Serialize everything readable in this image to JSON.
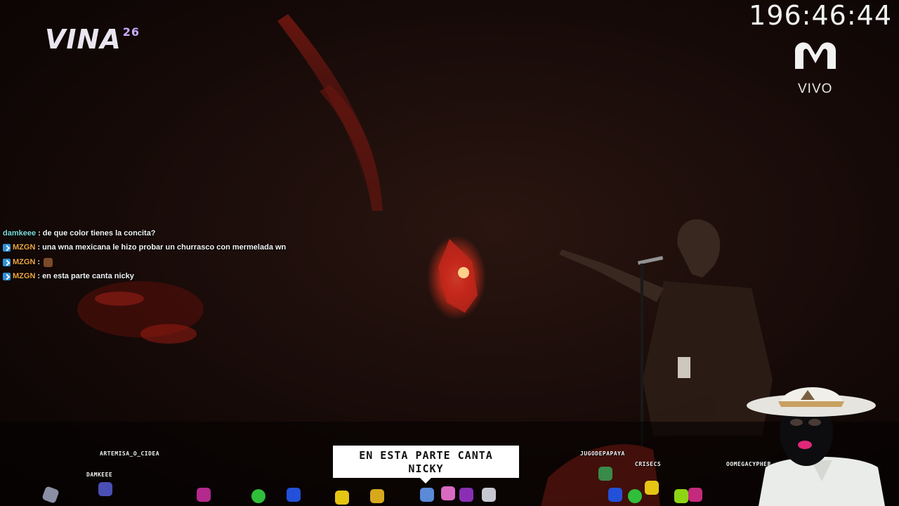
{
  "broadcast": {
    "event_logo_text": "VINA",
    "event_logo_year": "26",
    "clock": "196:46:44",
    "network_status": "VIVO"
  },
  "chat": {
    "messages": [
      {
        "user": "damkeee",
        "user_color": "#7fdcd9",
        "badge": false,
        "text": "de que color tienes la concita?",
        "emote": false
      },
      {
        "user": "MZGN",
        "user_color": "#f2a640",
        "badge": true,
        "text": "una wna mexicana le hizo probar un churrasco con mermelada wn",
        "emote": false
      },
      {
        "user": "MZGN",
        "user_color": "#f2a640",
        "badge": true,
        "text": "",
        "emote": true
      },
      {
        "user": "MZGN",
        "user_color": "#f2a640",
        "badge": true,
        "text": "en esta parte canta nicky",
        "emote": false
      }
    ],
    "separator": ":"
  },
  "caption": {
    "line1": "EN ESTA PARTE CANTA",
    "line2": "NICKY"
  },
  "avatars": {
    "names": [
      "ARTEMISA_O_CIDEA",
      "DAMKEEE",
      "JUGODEPAPAYA",
      "CRISECS",
      "OOMEGACYPHER"
    ]
  },
  "colors": {
    "stage_red": "#c0261a",
    "caption_bg": "#ffffff",
    "badge_blue": "#2f8fd6"
  }
}
